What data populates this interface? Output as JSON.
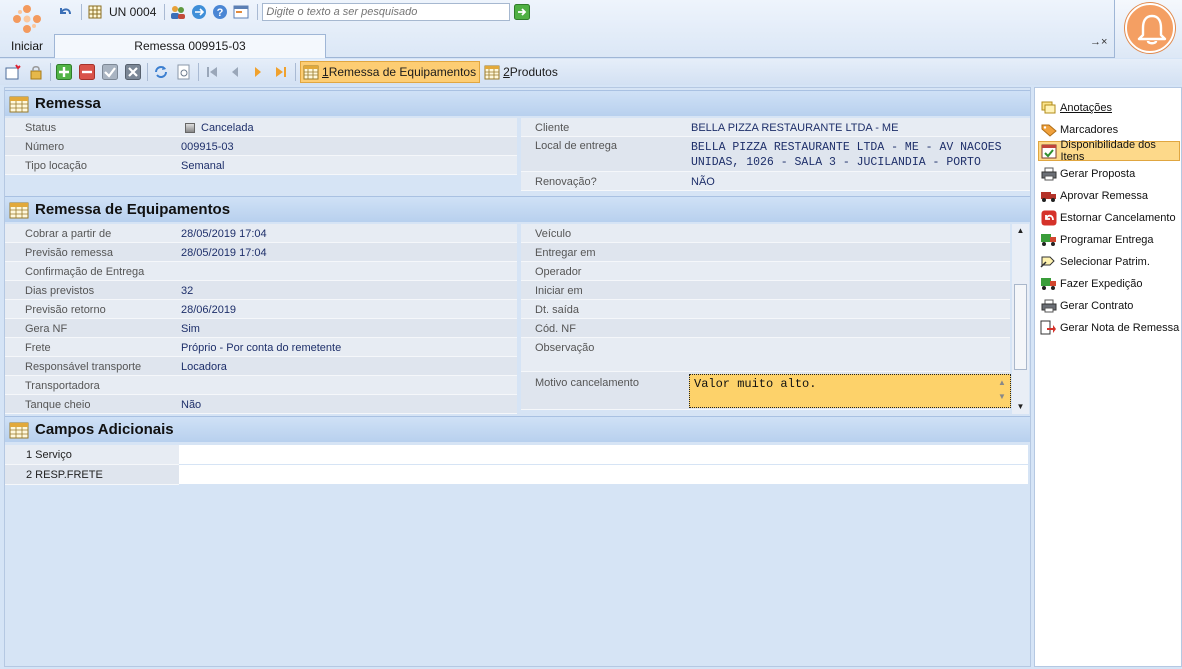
{
  "topbar": {
    "start_label": "Iniciar",
    "unit_label": "UN 0004",
    "search_placeholder": "Digite o texto a ser pesquisado",
    "document_tab": "Remessa 009915-03",
    "close_glyph": "→×"
  },
  "toolbar": {
    "tab_remessa_equipamentos": {
      "key": "1",
      "label": " Remessa de Equipamentos"
    },
    "tab_produtos": {
      "key": "2",
      "label": " Produtos"
    }
  },
  "remessa": {
    "title": "Remessa",
    "status_label": "Status",
    "status_value": "Cancelada",
    "numero_label": "Número",
    "numero_value": "009915-03",
    "tipo_label": "Tipo locação",
    "tipo_value": "Semanal",
    "cliente_label": "Cliente",
    "cliente_value": "BELLA PIZZA RESTAURANTE LTDA - ME",
    "local_label": "Local de entrega",
    "local_value_line1": "BELLA PIZZA RESTAURANTE LTDA - ME - AV NACOES",
    "local_value_line2": "UNIDAS, 1026 - SALA  3 - JUCILANDIA - PORTO",
    "renovacao_label": "Renovação?",
    "renovacao_value": "NÃO"
  },
  "equipamentos": {
    "title": "Remessa de Equipamentos",
    "left": [
      {
        "label": "Cobrar a partir de",
        "value": "28/05/2019 17:04"
      },
      {
        "label": "Previsão remessa",
        "value": "28/05/2019 17:04"
      },
      {
        "label": "Confirmação de Entrega",
        "value": ""
      },
      {
        "label": "Dias previstos",
        "value": "32"
      },
      {
        "label": "Previsão retorno",
        "value": "28/06/2019"
      },
      {
        "label": "Gera NF",
        "value": "Sim"
      },
      {
        "label": "Frete",
        "value": "Próprio - Por conta do remetente"
      },
      {
        "label": "Responsável transporte",
        "value": "Locadora"
      },
      {
        "label": "Transportadora",
        "value": ""
      },
      {
        "label": "Tanque cheio",
        "value": "Não"
      }
    ],
    "right": [
      {
        "label": "Veículo",
        "value": ""
      },
      {
        "label": "Entregar em",
        "value": ""
      },
      {
        "label": "Operador",
        "value": ""
      },
      {
        "label": "Iniciar em",
        "value": ""
      },
      {
        "label": "Dt. saída",
        "value": ""
      },
      {
        "label": "Cód. NF",
        "value": ""
      },
      {
        "label": "Observação",
        "value": ""
      }
    ],
    "motivo_label": "Motivo cancelamento",
    "motivo_value": "Valor muito alto."
  },
  "adicionais": {
    "title": "Campos Adicionais",
    "rows": [
      {
        "label": "1 Serviço",
        "value": ""
      },
      {
        "label": "2 RESP.FRETE",
        "value": ""
      }
    ]
  },
  "side_actions": [
    {
      "label": "Anotações",
      "underline": "A",
      "rest": "notações"
    },
    {
      "label": "Marcadores"
    },
    {
      "label": "Disponibilidade dos Itens"
    },
    {
      "label": "Gerar Proposta"
    },
    {
      "label": "Aprovar Remessa"
    },
    {
      "label": "Estornar Cancelamento"
    },
    {
      "label": "Programar Entrega"
    },
    {
      "label": "Selecionar Patrim."
    },
    {
      "label": "Fazer Expedição"
    },
    {
      "label": "Gerar Contrato"
    },
    {
      "label": "Gerar Nota de Remessa"
    }
  ],
  "colors": {
    "accent_orange": "#f49f63",
    "active_tab": "#fdcd73",
    "motivo_bg": "#fdd26a",
    "value_text": "#1e2f6a"
  }
}
